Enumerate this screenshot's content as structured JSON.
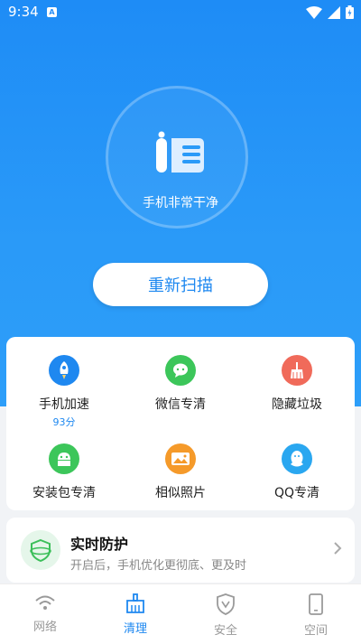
{
  "status_bar": {
    "time": "9:34",
    "badge": "A"
  },
  "hero": {
    "status_text": "手机非常干净",
    "rescan_label": "重新扫描"
  },
  "tools": [
    {
      "label": "手机加速",
      "sub": "93分",
      "icon": "rocket-icon",
      "color": "#1e88f0"
    },
    {
      "label": "微信专清",
      "sub": "",
      "icon": "wechat-icon",
      "color": "#3cc65a"
    },
    {
      "label": "隐藏垃圾",
      "sub": "",
      "icon": "broom-icon",
      "color": "#f06a5a"
    },
    {
      "label": "安装包专清",
      "sub": "",
      "icon": "android-icon",
      "color": "#3cc65a"
    },
    {
      "label": "相似照片",
      "sub": "",
      "icon": "photo-icon",
      "color": "#f59a2a"
    },
    {
      "label": "QQ专清",
      "sub": "",
      "icon": "qq-icon",
      "color": "#2aa7f0"
    }
  ],
  "realtime": {
    "title": "实时防护",
    "desc": "开启后，手机优化更彻底、更及时"
  },
  "nav": [
    {
      "label": "网络",
      "icon": "wifi-icon"
    },
    {
      "label": "清理",
      "icon": "broom-nav-icon"
    },
    {
      "label": "安全",
      "icon": "shield-icon"
    },
    {
      "label": "空间",
      "icon": "phone-icon"
    }
  ],
  "colors": {
    "accent": "#1e88f0",
    "hero_bg": "#2a9af8"
  }
}
